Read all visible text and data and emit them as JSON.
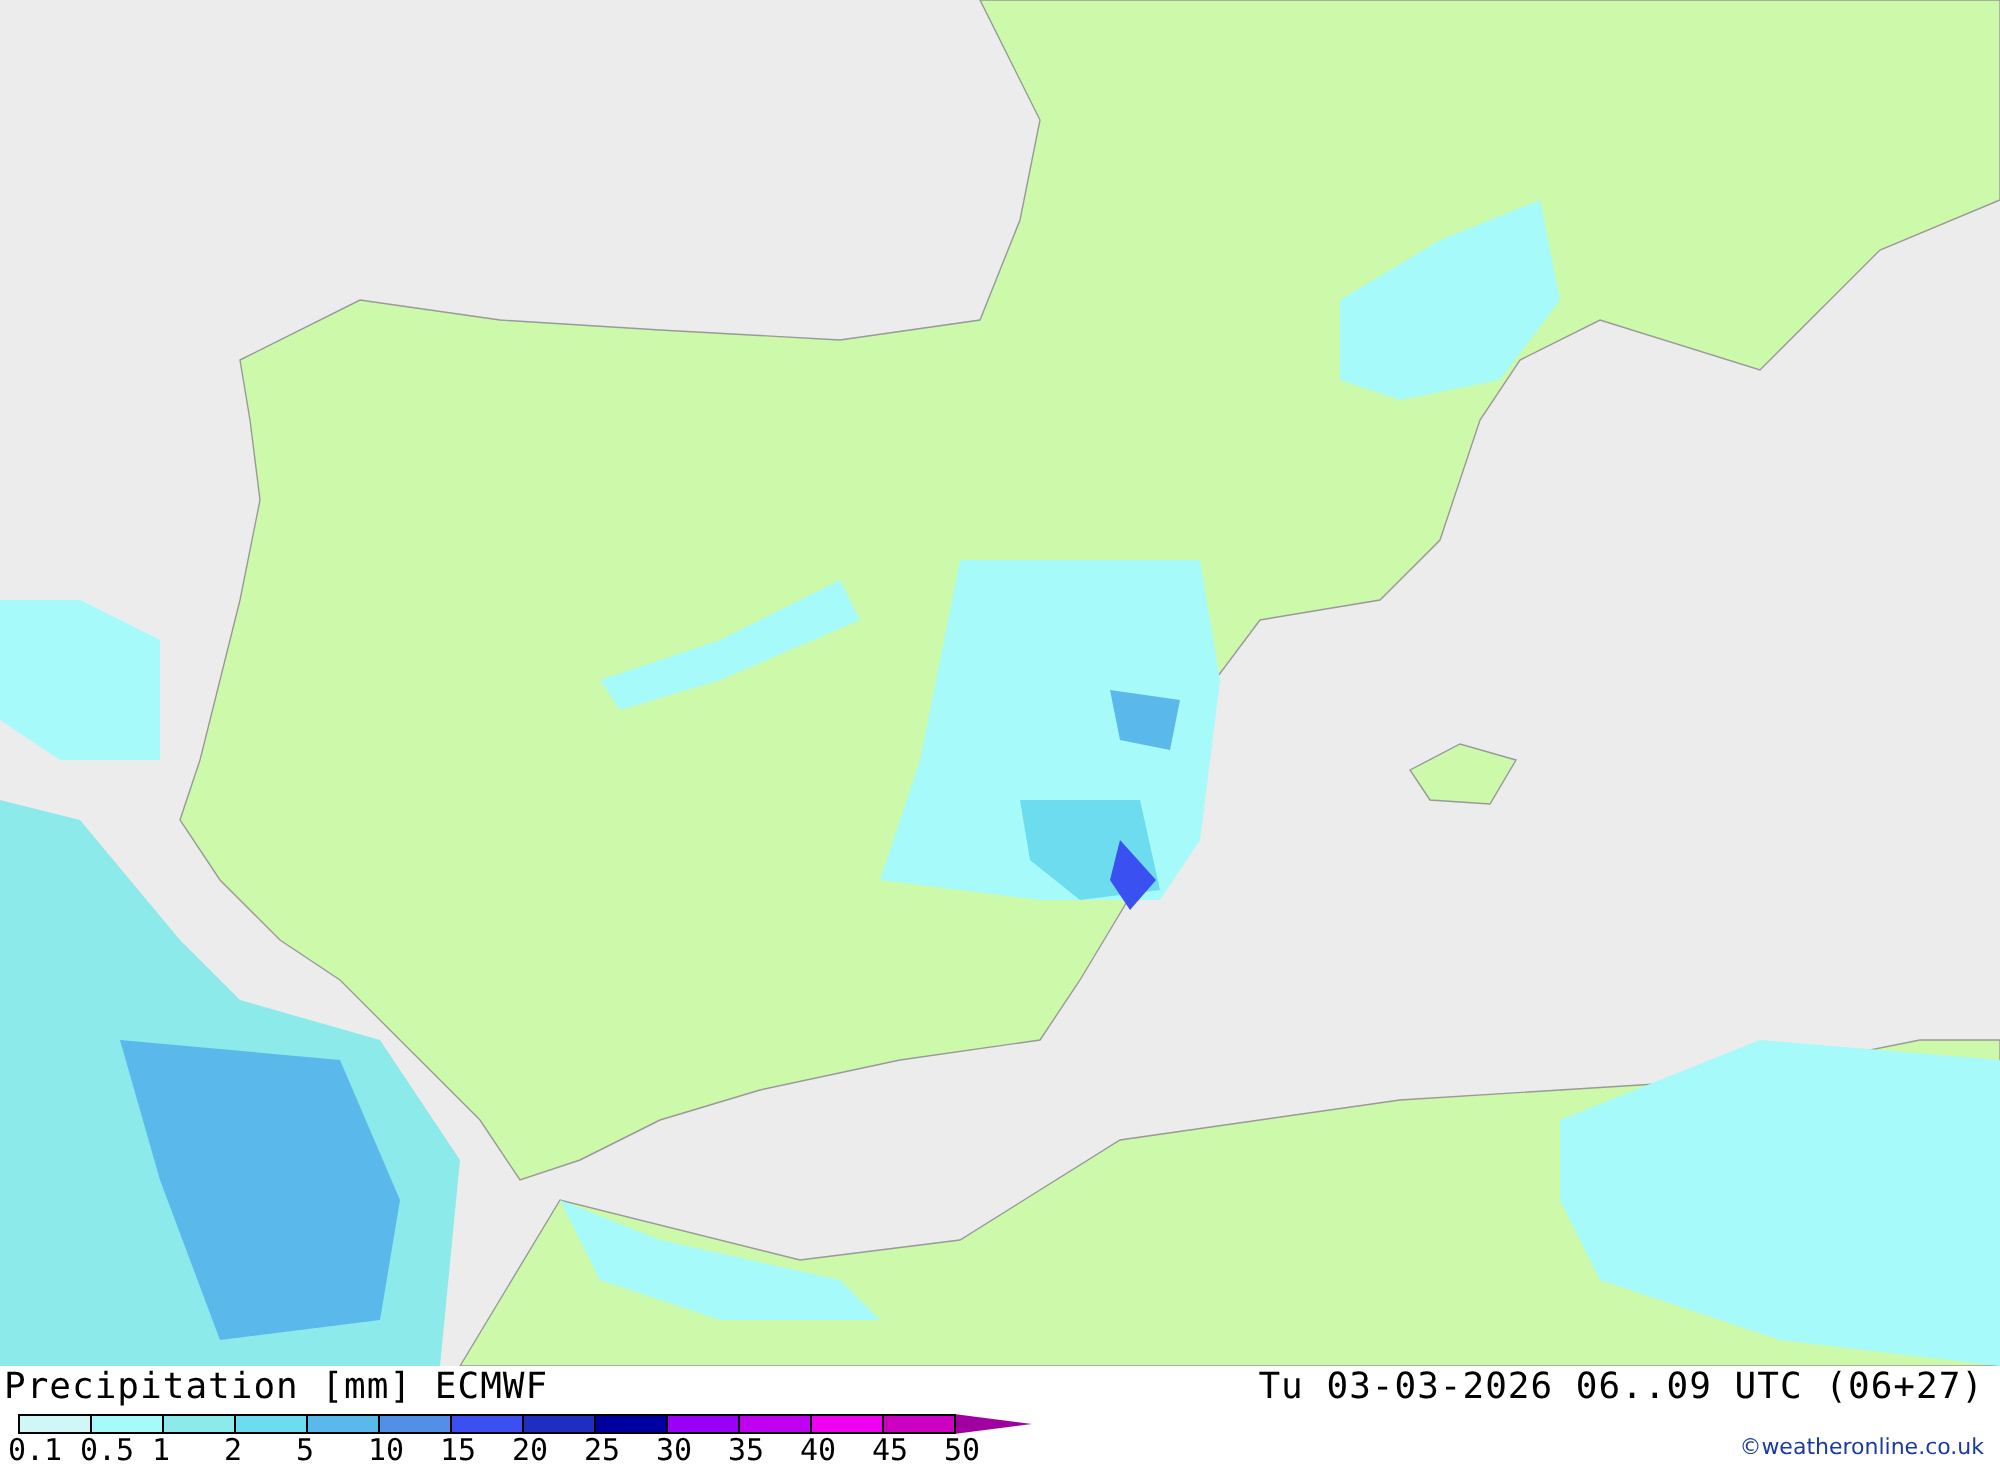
{
  "map": {
    "title": "Precipitation [mm] ECMWF",
    "valid_time": "Tu 03-03-2026 06..09 UTC (06+27)",
    "credit": "©weatheronline.co.uk"
  },
  "legend": [
    {
      "label": "0.1",
      "color": "#cff7f7"
    },
    {
      "label": "0.5",
      "color": "#a6fafa"
    },
    {
      "label": "1",
      "color": "#8ceaea"
    },
    {
      "label": "2",
      "color": "#6cdcee"
    },
    {
      "label": "5",
      "color": "#5ab8ea"
    },
    {
      "label": "10",
      "color": "#5290e6"
    },
    {
      "label": "15",
      "color": "#3a50f0"
    },
    {
      "label": "20",
      "color": "#1e2ebe"
    },
    {
      "label": "25",
      "color": "#0000a0"
    },
    {
      "label": "30",
      "color": "#9800f8"
    },
    {
      "label": "35",
      "color": "#c000f0"
    },
    {
      "label": "40",
      "color": "#f000f0"
    },
    {
      "label": "45",
      "color": "#cc00c0"
    },
    {
      "label": "50",
      "color": "#a000a0"
    }
  ]
}
